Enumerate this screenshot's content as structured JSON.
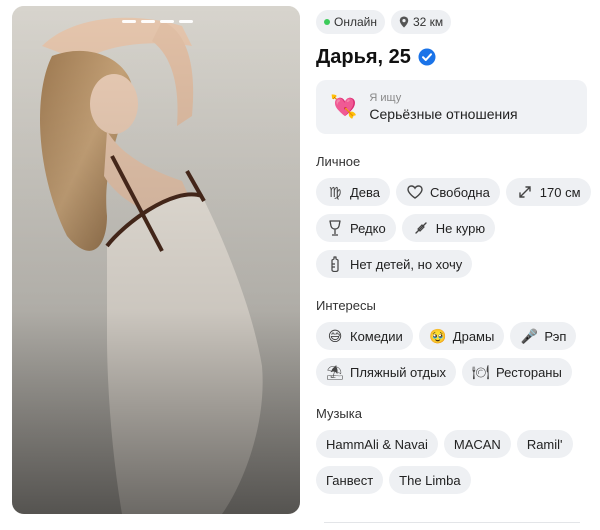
{
  "photo": {
    "indicator_count": 4
  },
  "status": {
    "online_label": "Онлайн",
    "distance_label": "32 км"
  },
  "profile": {
    "name_age": "Дарья, 25",
    "verified": true
  },
  "looking_for": {
    "label": "Я ищу",
    "value": "Серьёзные отношения",
    "icon": "heart-arrow-emoji"
  },
  "personal": {
    "title": "Личное",
    "chips": [
      {
        "label": "Дева",
        "icon": "virgo-icon"
      },
      {
        "label": "Свободна",
        "icon": "heart-outline-icon"
      },
      {
        "label": "170 см",
        "icon": "height-arrows-icon"
      },
      {
        "label": "Редко",
        "icon": "wine-glass-icon"
      },
      {
        "label": "Не курю",
        "icon": "no-smoking-icon"
      },
      {
        "label": "Нет детей, но хочу",
        "icon": "baby-bottle-icon"
      }
    ]
  },
  "interests": {
    "title": "Интересы",
    "chips": [
      {
        "label": "Комедии",
        "icon": "laughing-emoji"
      },
      {
        "label": "Драмы",
        "icon": "crying-emoji"
      },
      {
        "label": "Рэп",
        "icon": "microphone-emoji"
      },
      {
        "label": "Пляжный отдых",
        "icon": "beach-umbrella-emoji"
      },
      {
        "label": "Рестораны",
        "icon": "fork-knife-emoji"
      }
    ]
  },
  "music": {
    "title": "Музыка",
    "chips": [
      {
        "label": "HammAli & Navai"
      },
      {
        "label": "MACAN"
      },
      {
        "label": "Ramil'"
      },
      {
        "label": "Ганвест"
      },
      {
        "label": "The Limba"
      }
    ]
  },
  "colors": {
    "chip_bg": "#eef0f3",
    "online": "#3ccb5a",
    "verified": "#1a73e8"
  }
}
